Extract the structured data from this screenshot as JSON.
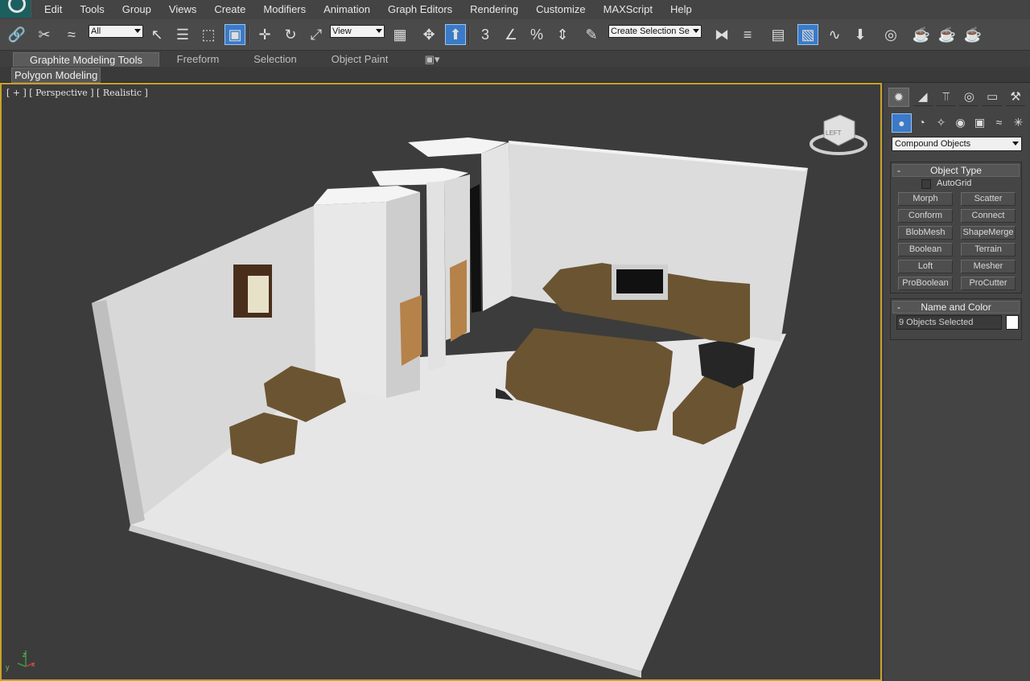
{
  "menubar": {
    "items": [
      "Edit",
      "Tools",
      "Group",
      "Views",
      "Create",
      "Modifiers",
      "Animation",
      "Graph Editors",
      "Rendering",
      "Customize",
      "MAXScript",
      "Help"
    ]
  },
  "toolbar": {
    "selection_filter": "All",
    "reference_coord": "View",
    "named_selection": "Create Selection Se",
    "snap_number": "3",
    "percent_glyph": "%"
  },
  "ribbon": {
    "tabs": [
      "Graphite Modeling Tools",
      "Freeform",
      "Selection",
      "Object Paint"
    ],
    "active_tab": "Graphite Modeling Tools",
    "subtab": "Polygon Modeling"
  },
  "viewport": {
    "label": "[ + ] [ Perspective ] [ Realistic ]",
    "viewcube_face": "LEFT",
    "axis_x": "x",
    "axis_y": "y",
    "axis_z": "z",
    "colors": {
      "border_active": "#c7a32a",
      "background": "#3c3c3c",
      "floor": "#e8e8e8",
      "furniture": "#6b5432"
    }
  },
  "command_panel": {
    "category_dropdown": "Compound Objects",
    "object_type": {
      "title": "Object Type",
      "autogrid_label": "AutoGrid",
      "buttons": [
        "Morph",
        "Scatter",
        "Conform",
        "Connect",
        "BlobMesh",
        "ShapeMerge",
        "Boolean",
        "Terrain",
        "Loft",
        "Mesher",
        "ProBoolean",
        "ProCutter"
      ]
    },
    "name_color": {
      "title": "Name and Color",
      "name_value": "9 Objects Selected",
      "swatch_color": "#ffffff"
    },
    "collapse_glyph": "-"
  }
}
